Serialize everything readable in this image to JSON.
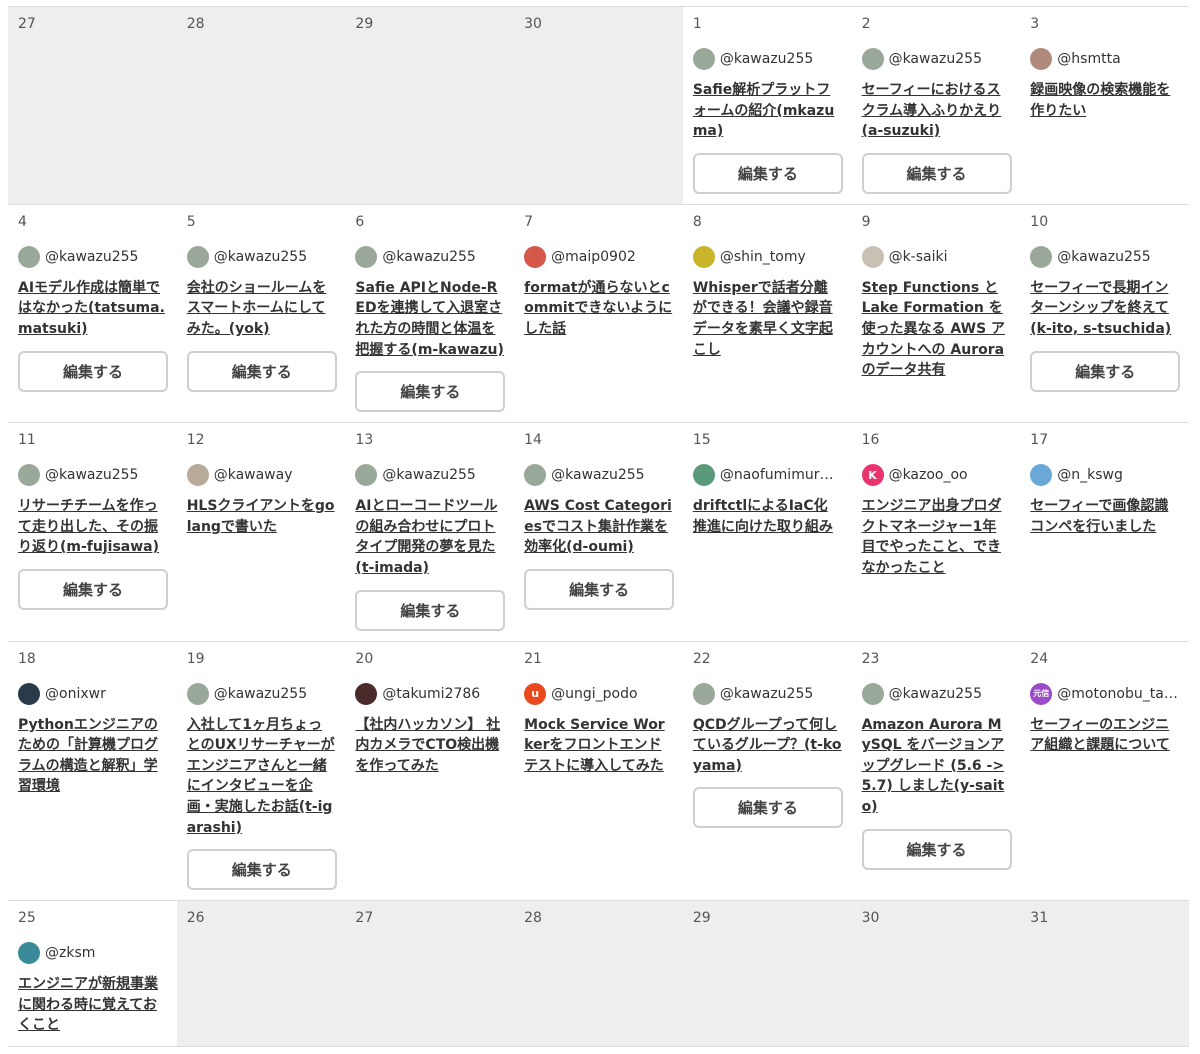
{
  "edit_label": "編集する",
  "weeks": [
    [
      {
        "day": "27",
        "other_month": true
      },
      {
        "day": "28",
        "other_month": true
      },
      {
        "day": "29",
        "other_month": true
      },
      {
        "day": "30",
        "other_month": true
      },
      {
        "day": "1",
        "user": "@kawazu255",
        "avatar": "kawazu",
        "title": "Safie解析プラットフォームの紹介(mkazuma)",
        "editable": true
      },
      {
        "day": "2",
        "user": "@kawazu255",
        "avatar": "kawazu",
        "title": "セーフィーにおけるスクラム導入ふりかえり(a-suzuki)",
        "editable": true
      },
      {
        "day": "3",
        "user": "@hsmtta",
        "avatar": "hsmtta",
        "title": "録画映像の検索機能を作りたい",
        "editable": false
      }
    ],
    [
      {
        "day": "4",
        "user": "@kawazu255",
        "avatar": "kawazu",
        "title": "AIモデル作成は簡単ではなかった(tatsuma.matsuki)",
        "editable": true
      },
      {
        "day": "5",
        "user": "@kawazu255",
        "avatar": "kawazu",
        "title": "会社のショールームをスマートホームにしてみた。(yok)",
        "editable": true
      },
      {
        "day": "6",
        "user": "@kawazu255",
        "avatar": "kawazu",
        "title": "Safie APIとNode-REDを連携して入退室された方の時間と体温を把握する(m-kawazu)",
        "editable": true
      },
      {
        "day": "7",
        "user": "@maip0902",
        "avatar": "maip",
        "title": "formatが通らないとcommitできないようにした話",
        "editable": false
      },
      {
        "day": "8",
        "user": "@shin_tomy",
        "avatar": "shin",
        "title": "Whisperで話者分離ができる！会議や録音データを素早く文字起こし",
        "editable": false
      },
      {
        "day": "9",
        "user": "@k-saiki",
        "avatar": "ksaiki",
        "title": "Step Functions と Lake Formation を使った異なる AWS アカウントへの Aurora のデータ共有",
        "editable": false
      },
      {
        "day": "10",
        "user": "@kawazu255",
        "avatar": "kawazu",
        "title": "セーフィーで長期インターンシップを終えて(k-ito, s-tsuchida)",
        "editable": true
      }
    ],
    [
      {
        "day": "11",
        "user": "@kawazu255",
        "avatar": "kawazu",
        "title": "リサーチチームを作って走り出した、その振り返り(m-fujisawa)",
        "editable": true
      },
      {
        "day": "12",
        "user": "@kawaway",
        "avatar": "kawaway",
        "title": "HLSクライアントをgolangで書いた",
        "editable": false
      },
      {
        "day": "13",
        "user": "@kawazu255",
        "avatar": "kawazu",
        "title": "AIとローコードツールの組み合わせにプロトタイプ開発の夢を見た(t-imada)",
        "editable": true
      },
      {
        "day": "14",
        "user": "@kawazu255",
        "avatar": "kawazu",
        "title": "AWS Cost Categoriesでコスト集計作業を効率化(d-oumi)",
        "editable": true
      },
      {
        "day": "15",
        "user": "@naofumimurata",
        "avatar": "nao",
        "title": "driftctlによるIaC化推進に向けた取り組み",
        "editable": false
      },
      {
        "day": "16",
        "user": "@kazoo_oo",
        "avatar": "kazoo",
        "avatar_letter": "K",
        "title": "エンジニア出身プロダクトマネージャー1年目でやったこと、できなかったこと",
        "editable": false
      },
      {
        "day": "17",
        "user": "@n_kswg",
        "avatar": "nkswg",
        "title": "セーフィーで画像認識コンペを行いました",
        "editable": false
      }
    ],
    [
      {
        "day": "18",
        "user": "@onixwr",
        "avatar": "onix",
        "title": "Pythonエンジニアのための「計算機プログラムの構造と解釈」学習環境",
        "editable": false
      },
      {
        "day": "19",
        "user": "@kawazu255",
        "avatar": "kawazu",
        "title": "入社して1ヶ月ちょっとのUXリサーチャーがエンジニアさんと一緒にインタビューを企画・実施したお話(t-igarashi)",
        "editable": true
      },
      {
        "day": "20",
        "user": "@takumi2786",
        "avatar": "takumi",
        "title": "【社内ハッカソン】 社内カメラでCTO検出機を作ってみた",
        "editable": false
      },
      {
        "day": "21",
        "user": "@ungi_podo",
        "avatar": "ungi",
        "avatar_letter": "u",
        "title": "Mock Service Workerをフロントエンドテストに導入してみた",
        "editable": false
      },
      {
        "day": "22",
        "user": "@kawazu255",
        "avatar": "kawazu",
        "title": "QCDグループって何しているグループ？(t-koyama)",
        "editable": true
      },
      {
        "day": "23",
        "user": "@kawazu255",
        "avatar": "kawazu",
        "title": "Amazon Aurora MySQL をバージョンアップグレード (5.6 -> 5.7) しました(y-saito)",
        "editable": true
      },
      {
        "day": "24",
        "user": "@motonobu_tani...",
        "avatar": "motonobu",
        "avatar_letter": "元信",
        "title": "セーフィーのエンジニア組織と課題について",
        "editable": false
      }
    ],
    [
      {
        "day": "25",
        "user": "@zksm",
        "avatar": "zksm",
        "title": "エンジニアが新規事業に関わる時に覚えておくこと",
        "editable": false
      },
      {
        "day": "26",
        "other_month": true
      },
      {
        "day": "27",
        "other_month": true
      },
      {
        "day": "28",
        "other_month": true
      },
      {
        "day": "29",
        "other_month": true
      },
      {
        "day": "30",
        "other_month": true
      },
      {
        "day": "31",
        "other_month": true
      }
    ]
  ],
  "avatar_colors": {
    "kawazu": "#9aa89a",
    "hsmtta": "#b08a7a",
    "maip": "#d4574a",
    "shin": "#c8b52a",
    "ksaiki": "#c9c0b4",
    "kawaway": "#b7aa98",
    "nao": "#5a9a7a",
    "kazoo": "#e8336c",
    "nkswg": "#6aa8d8",
    "onix": "#2a3a4a",
    "takumi": "#4a2a2a",
    "ungi": "#e84a1e",
    "motonobu": "#9b4ac8",
    "zksm": "#3a8a9a"
  }
}
